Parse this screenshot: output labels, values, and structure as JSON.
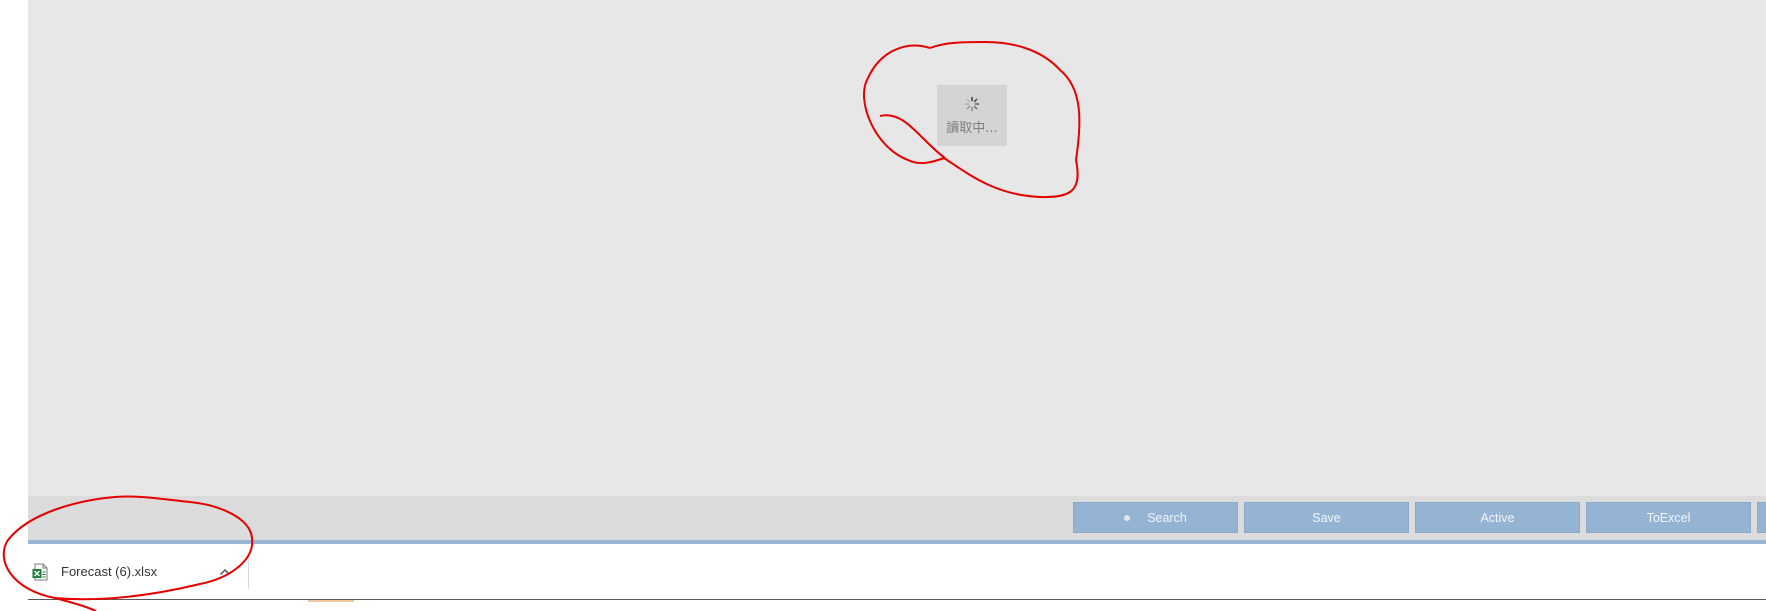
{
  "loading": {
    "text": "讀取中..."
  },
  "toolbar": {
    "buttons": [
      {
        "label": "Search",
        "icon": "dot-icon"
      },
      {
        "label": "Save"
      },
      {
        "label": "Active"
      },
      {
        "label": "ToExcel"
      }
    ]
  },
  "download": {
    "file_name": "Forecast (6).xlsx",
    "file_icon": "excel-file-icon",
    "chevron_icon": "chevron-up-icon"
  },
  "colors": {
    "content_bg": "#e7e7e7",
    "button_bg": "#95b3d3",
    "button_text": "#f3f6fa",
    "annotation": "#e60000"
  }
}
